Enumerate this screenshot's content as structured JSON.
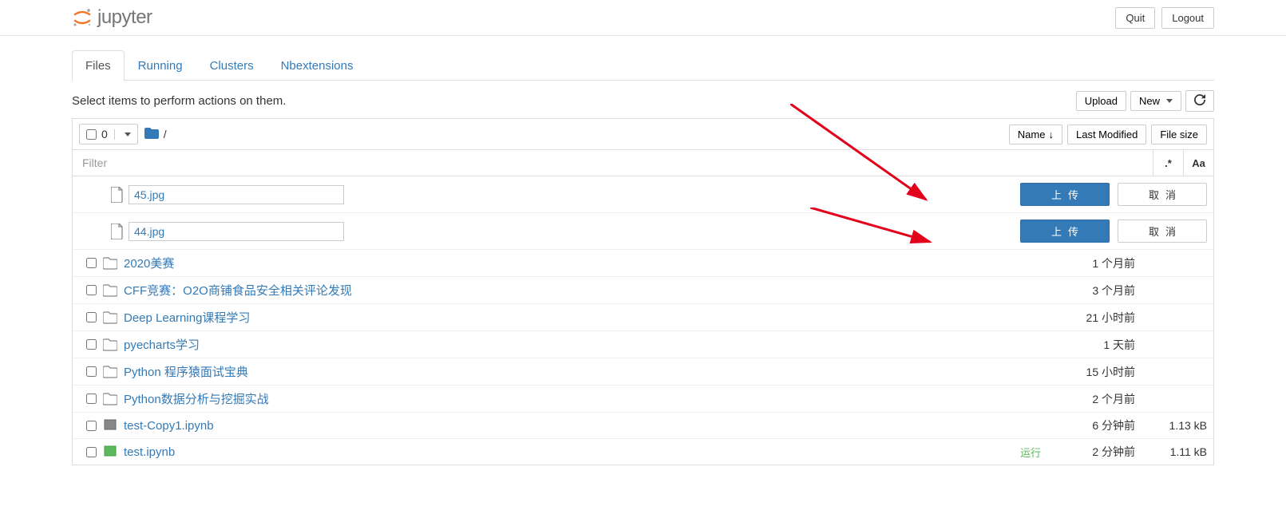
{
  "header": {
    "logo_text": "jupyter",
    "quit": "Quit",
    "logout": "Logout"
  },
  "tabs": {
    "files": "Files",
    "running": "Running",
    "clusters": "Clusters",
    "nbextensions": "Nbextensions"
  },
  "toolbar": {
    "instruction": "Select items to perform actions on them.",
    "upload": "Upload",
    "new": "New",
    "select_count": "0",
    "breadcrumb_sep": "/",
    "name_col": "Name",
    "last_modified_col": "Last Modified",
    "file_size_col": "File size",
    "filter_placeholder": "Filter",
    "filter_ext": ".*",
    "filter_case": "Aa"
  },
  "uploads": [
    {
      "filename": "45.jpg",
      "upload_label": "上传",
      "cancel_label": "取消"
    },
    {
      "filename": "44.jpg",
      "upload_label": "上传",
      "cancel_label": "取消"
    }
  ],
  "files": [
    {
      "type": "folder",
      "name": "2020美赛",
      "modified": "1 个月前",
      "size": ""
    },
    {
      "type": "folder",
      "name": "CFF竞赛：O2O商铺食品安全相关评论发现",
      "modified": "3 个月前",
      "size": ""
    },
    {
      "type": "folder",
      "name": "Deep Learning课程学习",
      "modified": "21 小时前",
      "size": ""
    },
    {
      "type": "folder",
      "name": "pyecharts学习",
      "modified": "1 天前",
      "size": ""
    },
    {
      "type": "folder",
      "name": "Python 程序猿面试宝典",
      "modified": "15 小时前",
      "size": ""
    },
    {
      "type": "folder",
      "name": "Python数据分析与挖掘实战",
      "modified": "2 个月前",
      "size": ""
    },
    {
      "type": "notebook",
      "name": "test-Copy1.ipynb",
      "modified": "6 分钟前",
      "size": "1.13 kB"
    },
    {
      "type": "notebook-running",
      "name": "test.ipynb",
      "modified": "2 分钟前",
      "size": "1.11 kB",
      "status": "运行"
    }
  ]
}
